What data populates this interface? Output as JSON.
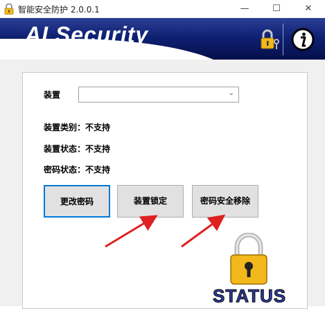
{
  "window": {
    "title": "智能安全防护 2.0.0.1",
    "minimize_symbol": "—",
    "maximize_symbol": "☐",
    "close_symbol": "✕"
  },
  "banner": {
    "title": "AI Security"
  },
  "form": {
    "device_label": "装置",
    "device_select_value": "",
    "device_type_label": "装置类别：不支持",
    "device_status_label": "装置状态：不支持",
    "password_status_label": "密码状态：不支持"
  },
  "buttons": {
    "change_password": "更改密码",
    "lock_device": "装置锁定",
    "remove_password": "密码安全移除"
  },
  "status": {
    "text": "STATUS"
  },
  "colors": {
    "banner_dark": "#0f2173",
    "focus_border": "#0078d7",
    "annotation_arrow": "#e02020",
    "lock_gold": "#f2b81c"
  }
}
